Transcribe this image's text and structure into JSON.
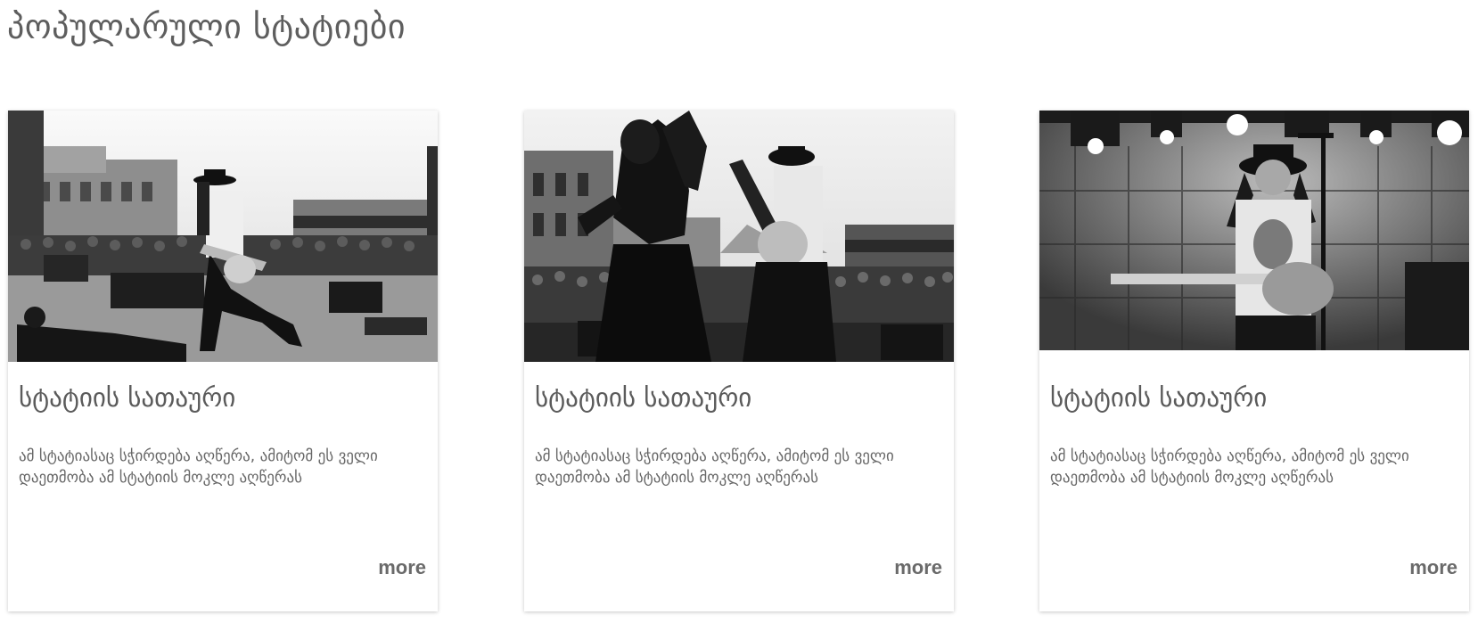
{
  "section": {
    "title": "პოპულარული სტატიები"
  },
  "cards": [
    {
      "image_icon": "concert-photo",
      "title": "სტატიის სათაური",
      "description": "ამ სტატიასაც სჭირდება აღწერა, ამიტომ ეს ველი დაეთმობა ამ სტატიის მოკლე აღწერას",
      "more_label": "more"
    },
    {
      "image_icon": "concert-photo",
      "title": "სტატიის სათაური",
      "description": "ამ სტატიასაც სჭირდება აღწერა, ამიტომ ეს ველი დაეთმობა ამ სტატიის მოკლე აღწერას",
      "more_label": "more"
    },
    {
      "image_icon": "concert-photo",
      "title": "სტატიის სათაური",
      "description": "ამ სტატიასაც სჭირდება აღწერა, ამიტომ ეს ველი დაეთმობა ამ სტატიის მოკლე აღწერას",
      "more_label": "more"
    }
  ]
}
